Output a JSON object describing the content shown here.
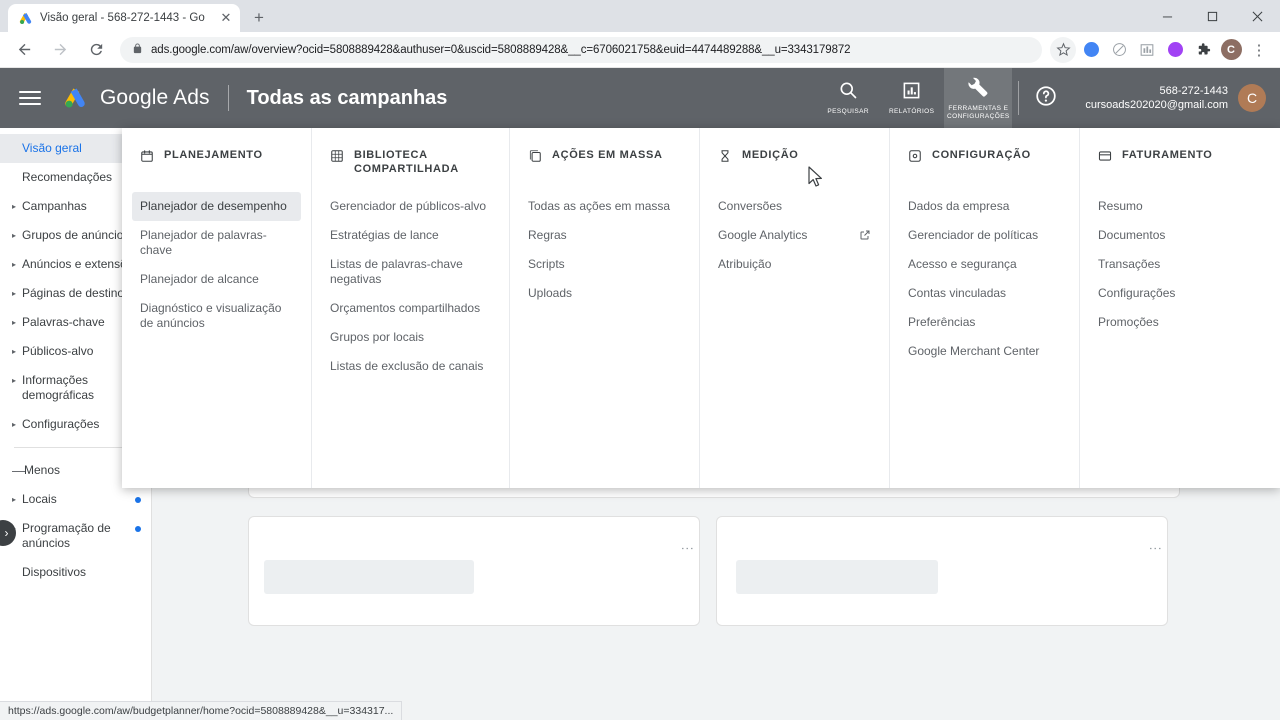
{
  "browser": {
    "tab": {
      "title": "Visão geral - 568-272-1443 - Go",
      "favicon_name": "google-ads-favicon",
      "close_label": "✕"
    },
    "new_tab_label": "+",
    "window_controls": {
      "minimize": "–",
      "maximize": "❐",
      "close": "✕"
    },
    "nav": {
      "back": "←",
      "forward": "→",
      "reload": "⟳"
    },
    "omnibox": {
      "lock_icon": "lock-icon",
      "url": "ads.google.com/aw/overview?ocid=5808889428&authuser=0&uscid=5808889428&__c=6706021758&euid=4474489288&__u=3343179872"
    },
    "toolbar_icons": [
      {
        "name": "bookmark-star-icon",
        "glyph": "☆",
        "color": "#5f6368"
      },
      {
        "name": "extension-blue-icon",
        "glyph": "",
        "color": "#4285f4"
      },
      {
        "name": "extension-gray-icon",
        "glyph": "",
        "color": "#9aa0a6"
      },
      {
        "name": "extension-chart-icon",
        "glyph": "",
        "color": "#9aa0a6"
      },
      {
        "name": "extension-purple-icon",
        "glyph": "",
        "color": "#a142f4"
      },
      {
        "name": "extensions-puzzle-icon",
        "glyph": "",
        "color": "#3c4043"
      }
    ],
    "profile": {
      "name": "profile-avatar",
      "initial": "C"
    },
    "menu_glyph": "⋮",
    "statusbar_url": "https://ads.google.com/aw/budgetplanner/home?ocid=5808889428&__u=334317..."
  },
  "ads_header": {
    "menu_icon": "hamburger-menu-icon",
    "logo_icon": "google-ads-logo",
    "brand": "Google Ads",
    "page_scope": "Todas as campanhas",
    "actions": [
      {
        "name": "search-button",
        "icon": "search-icon",
        "label": "PESQUISAR",
        "active": false
      },
      {
        "name": "reports-button",
        "icon": "reports-bar-chart-icon",
        "label": "RELATÓRIOS",
        "active": false
      },
      {
        "name": "tools-settings-button",
        "icon": "wrench-icon",
        "label": "FERRAMENTAS E CONFIGURAÇÕES",
        "active": true
      },
      {
        "name": "help-button",
        "icon": "help-circle-icon",
        "label": "",
        "active": false
      }
    ],
    "account": {
      "id": "568-272-1443",
      "email": "cursoads202020@gmail.com",
      "avatar_initial": "C"
    }
  },
  "sidebar": {
    "expand_handle_glyph": "›",
    "items": [
      {
        "label": "Visão geral",
        "caret": false,
        "selected": true,
        "dot": false,
        "wrap": false
      },
      {
        "label": "Recomendações",
        "caret": false,
        "selected": false,
        "dot": false,
        "wrap": false
      },
      {
        "label": "Campanhas",
        "caret": true,
        "selected": false,
        "dot": false,
        "wrap": false
      },
      {
        "label": "Grupos de anúncios",
        "caret": true,
        "selected": false,
        "dot": false,
        "wrap": false
      },
      {
        "label": "Anúncios e extensões",
        "caret": true,
        "selected": false,
        "dot": false,
        "wrap": true
      },
      {
        "label": "Páginas de destino",
        "caret": true,
        "selected": false,
        "dot": false,
        "wrap": false
      },
      {
        "label": "Palavras-chave",
        "caret": true,
        "selected": false,
        "dot": false,
        "wrap": false
      },
      {
        "label": "Públicos-alvo",
        "caret": true,
        "selected": false,
        "dot": false,
        "wrap": false
      },
      {
        "label": "Informações demográficas",
        "caret": true,
        "selected": false,
        "dot": false,
        "wrap": true
      },
      {
        "label": "Configurações",
        "caret": true,
        "selected": false,
        "dot": false,
        "wrap": false
      }
    ],
    "less_toggle": {
      "label": "Menos",
      "icon": "minus-icon"
    },
    "items_more": [
      {
        "label": "Locais",
        "caret": true,
        "dot": true,
        "wrap": false
      },
      {
        "label": "Programação de anúncios",
        "caret": true,
        "dot": true,
        "wrap": true
      },
      {
        "label": "Dispositivos",
        "caret": false,
        "dot": false,
        "wrap": false
      }
    ]
  },
  "megamenu": {
    "columns": [
      {
        "name": "planejamento",
        "icon": "calendar-icon",
        "title": "PLANEJAMENTO",
        "items": [
          {
            "label": "Planejador de desempenho",
            "highlighted": true,
            "external": false
          },
          {
            "label": "Planejador de palavras-chave",
            "highlighted": false,
            "external": false
          },
          {
            "label": "Planejador de alcance",
            "highlighted": false,
            "external": false
          },
          {
            "label": "Diagnóstico e visualização de anúncios",
            "highlighted": false,
            "external": false
          }
        ]
      },
      {
        "name": "biblioteca-compartilhada",
        "icon": "library-grid-icon",
        "title": "BIBLIOTECA COMPARTILHADA",
        "items": [
          {
            "label": "Gerenciador de públicos-alvo",
            "highlighted": false,
            "external": false
          },
          {
            "label": "Estratégias de lance",
            "highlighted": false,
            "external": false
          },
          {
            "label": "Listas de palavras-chave negativas",
            "highlighted": false,
            "external": false
          },
          {
            "label": "Orçamentos compartilhados",
            "highlighted": false,
            "external": false
          },
          {
            "label": "Grupos por locais",
            "highlighted": false,
            "external": false
          },
          {
            "label": "Listas de exclusão de canais",
            "highlighted": false,
            "external": false
          }
        ]
      },
      {
        "name": "acoes-em-massa",
        "icon": "bulk-actions-icon",
        "title": "AÇÕES EM MASSA",
        "items": [
          {
            "label": "Todas as ações em massa",
            "highlighted": false,
            "external": false
          },
          {
            "label": "Regras",
            "highlighted": false,
            "external": false
          },
          {
            "label": "Scripts",
            "highlighted": false,
            "external": false
          },
          {
            "label": "Uploads",
            "highlighted": false,
            "external": false
          }
        ]
      },
      {
        "name": "medicao",
        "icon": "measurement-hourglass-icon",
        "title": "MEDIÇÃO",
        "items": [
          {
            "label": "Conversões",
            "highlighted": false,
            "external": false
          },
          {
            "label": "Google Analytics",
            "highlighted": false,
            "external": true
          },
          {
            "label": "Atribuição",
            "highlighted": false,
            "external": false
          }
        ]
      },
      {
        "name": "configuracao",
        "icon": "settings-square-icon",
        "title": "CONFIGURAÇÃO",
        "items": [
          {
            "label": "Dados da empresa",
            "highlighted": false,
            "external": false
          },
          {
            "label": "Gerenciador de políticas",
            "highlighted": false,
            "external": false
          },
          {
            "label": "Acesso e segurança",
            "highlighted": false,
            "external": false
          },
          {
            "label": "Contas vinculadas",
            "highlighted": false,
            "external": false
          },
          {
            "label": "Preferências",
            "highlighted": false,
            "external": false
          },
          {
            "label": "Google Merchant Center",
            "highlighted": false,
            "external": false
          }
        ]
      },
      {
        "name": "faturamento",
        "icon": "billing-card-icon",
        "title": "FATURAMENTO",
        "items": [
          {
            "label": "Resumo",
            "highlighted": false,
            "external": false
          },
          {
            "label": "Documentos",
            "highlighted": false,
            "external": false
          },
          {
            "label": "Transações",
            "highlighted": false,
            "external": false
          },
          {
            "label": "Configurações",
            "highlighted": false,
            "external": false
          },
          {
            "label": "Promoções",
            "highlighted": false,
            "external": false
          }
        ]
      }
    ]
  },
  "colors": {
    "header_bg": "#5f6368",
    "accent_blue": "#1a73e8",
    "page_bg": "#f1f3f4",
    "skeleton": "#eceff1"
  }
}
